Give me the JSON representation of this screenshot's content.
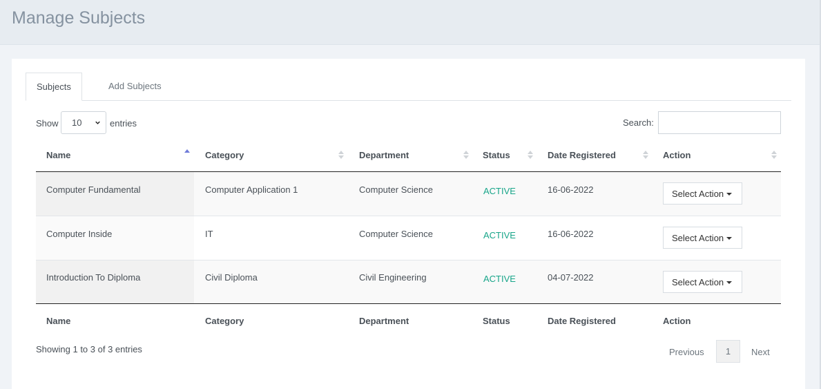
{
  "header": {
    "title": "Manage Subjects"
  },
  "tabs": [
    {
      "label": "Subjects",
      "active": true
    },
    {
      "label": "Add Subjects",
      "active": false
    }
  ],
  "length_control": {
    "show_label": "Show",
    "value": "10",
    "entries_label": "entries"
  },
  "search": {
    "label": "Search:",
    "value": ""
  },
  "table": {
    "columns": [
      "Name",
      "Category",
      "Department",
      "Status",
      "Date Registered",
      "Action"
    ],
    "rows": [
      {
        "name": "Computer Fundamental",
        "category": "Computer Application 1",
        "department": "Computer Science",
        "status": "ACTIVE",
        "date": "16-06-2022",
        "action": "Select Action"
      },
      {
        "name": "Computer Inside",
        "category": "IT",
        "department": "Computer Science",
        "status": "ACTIVE",
        "date": "16-06-2022",
        "action": "Select Action"
      },
      {
        "name": "Introduction To Diploma",
        "category": "Civil Diploma",
        "department": "Civil Engineering",
        "status": "ACTIVE",
        "date": "04-07-2022",
        "action": "Select Action"
      }
    ]
  },
  "info": "Showing 1 to 3 of 3 entries",
  "pagination": {
    "previous": "Previous",
    "current": "1",
    "next": "Next"
  },
  "colors": {
    "status_active": "#17a589",
    "sort_active": "#6f7bd9"
  }
}
